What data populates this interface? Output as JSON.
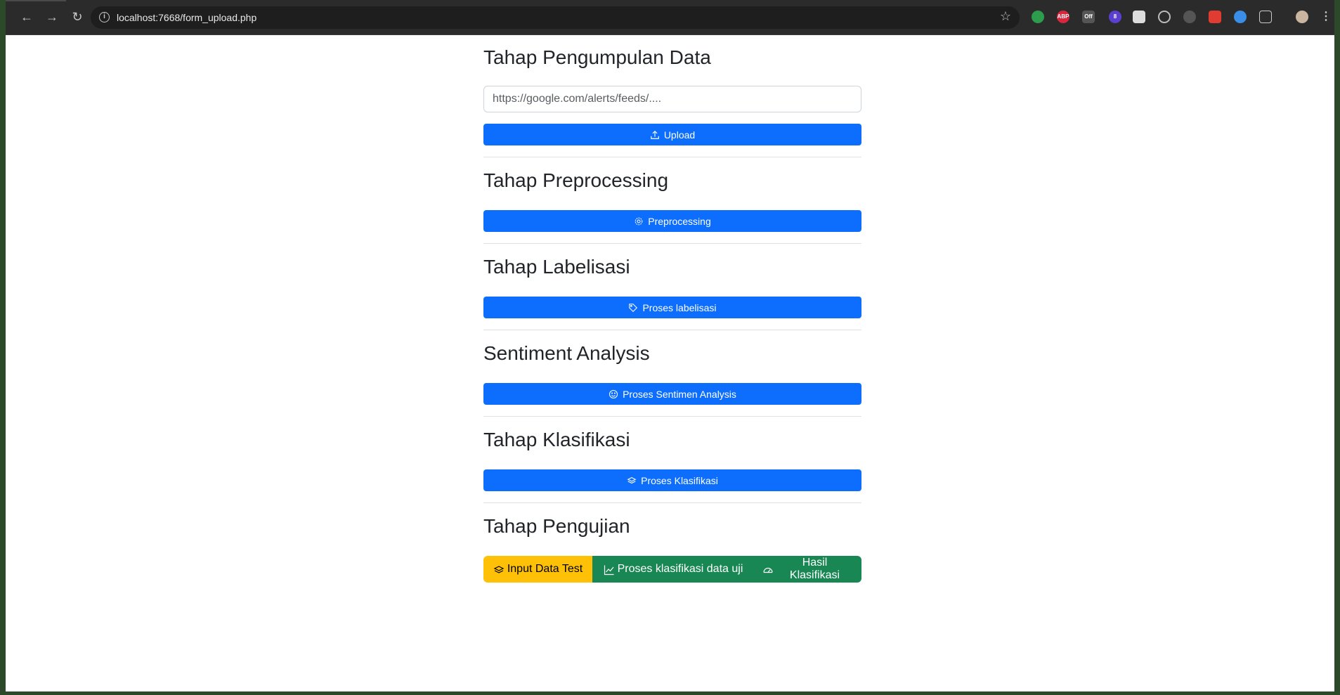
{
  "browser": {
    "url": "localhost:7668/form_upload.php"
  },
  "sections": {
    "collection": {
      "title": "Tahap Pengumpulan Data",
      "input_placeholder": "https://google.com/alerts/feeds/....",
      "button_label": "Upload"
    },
    "preprocessing": {
      "title": "Tahap Preprocessing",
      "button_label": "Preprocessing"
    },
    "labeling": {
      "title": "Tahap Labelisasi",
      "button_label": "Proses labelisasi"
    },
    "sentiment": {
      "title": "Sentiment Analysis",
      "button_label": "Proses Sentimen Analysis"
    },
    "classification": {
      "title": "Tahap Klasifikasi",
      "button_label": "Proses Klasifikasi"
    },
    "testing": {
      "title": "Tahap Pengujian",
      "input_label": "Input Data Test",
      "process_label": "Proses klasifikasi data uji",
      "result_label": "Hasil Klasifikasi"
    }
  },
  "colors": {
    "primary": "#0d6efd",
    "warning": "#ffc107",
    "success": "#198754"
  },
  "extensions": {
    "abp": "ABP",
    "off": "Off",
    "badge": "8"
  }
}
